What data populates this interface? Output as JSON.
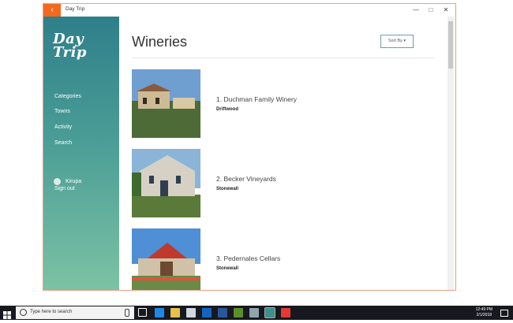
{
  "window": {
    "title": "Day Trip",
    "back_glyph": "‹"
  },
  "window_controls": {
    "minimize": "—",
    "maximize": "□",
    "close": "✕"
  },
  "logo": {
    "line1": "Day",
    "line2": "Trip"
  },
  "nav": {
    "items": [
      "Categories",
      "Towns",
      "Activity",
      "Search"
    ]
  },
  "user": {
    "name": "Kirupa",
    "signout": "Sign out"
  },
  "page": {
    "title": "Wineries",
    "sort_label": "Sort By ▾"
  },
  "wineries": [
    {
      "name": "1. Duchman Family Winery",
      "location": "Driftwood"
    },
    {
      "name": "2. Becker Vineyards",
      "location": "Stonewall"
    },
    {
      "name": "3. Pedernales Cellars",
      "location": "Stonewall"
    }
  ],
  "taskbar": {
    "search_placeholder": "Type here to search",
    "time": "12:49 PM",
    "date": "2/1/2018"
  },
  "colors": {
    "accent": "#f36a1f",
    "sidebar_top": "#2f7f8a",
    "sidebar_bottom": "#7cc2a4"
  }
}
